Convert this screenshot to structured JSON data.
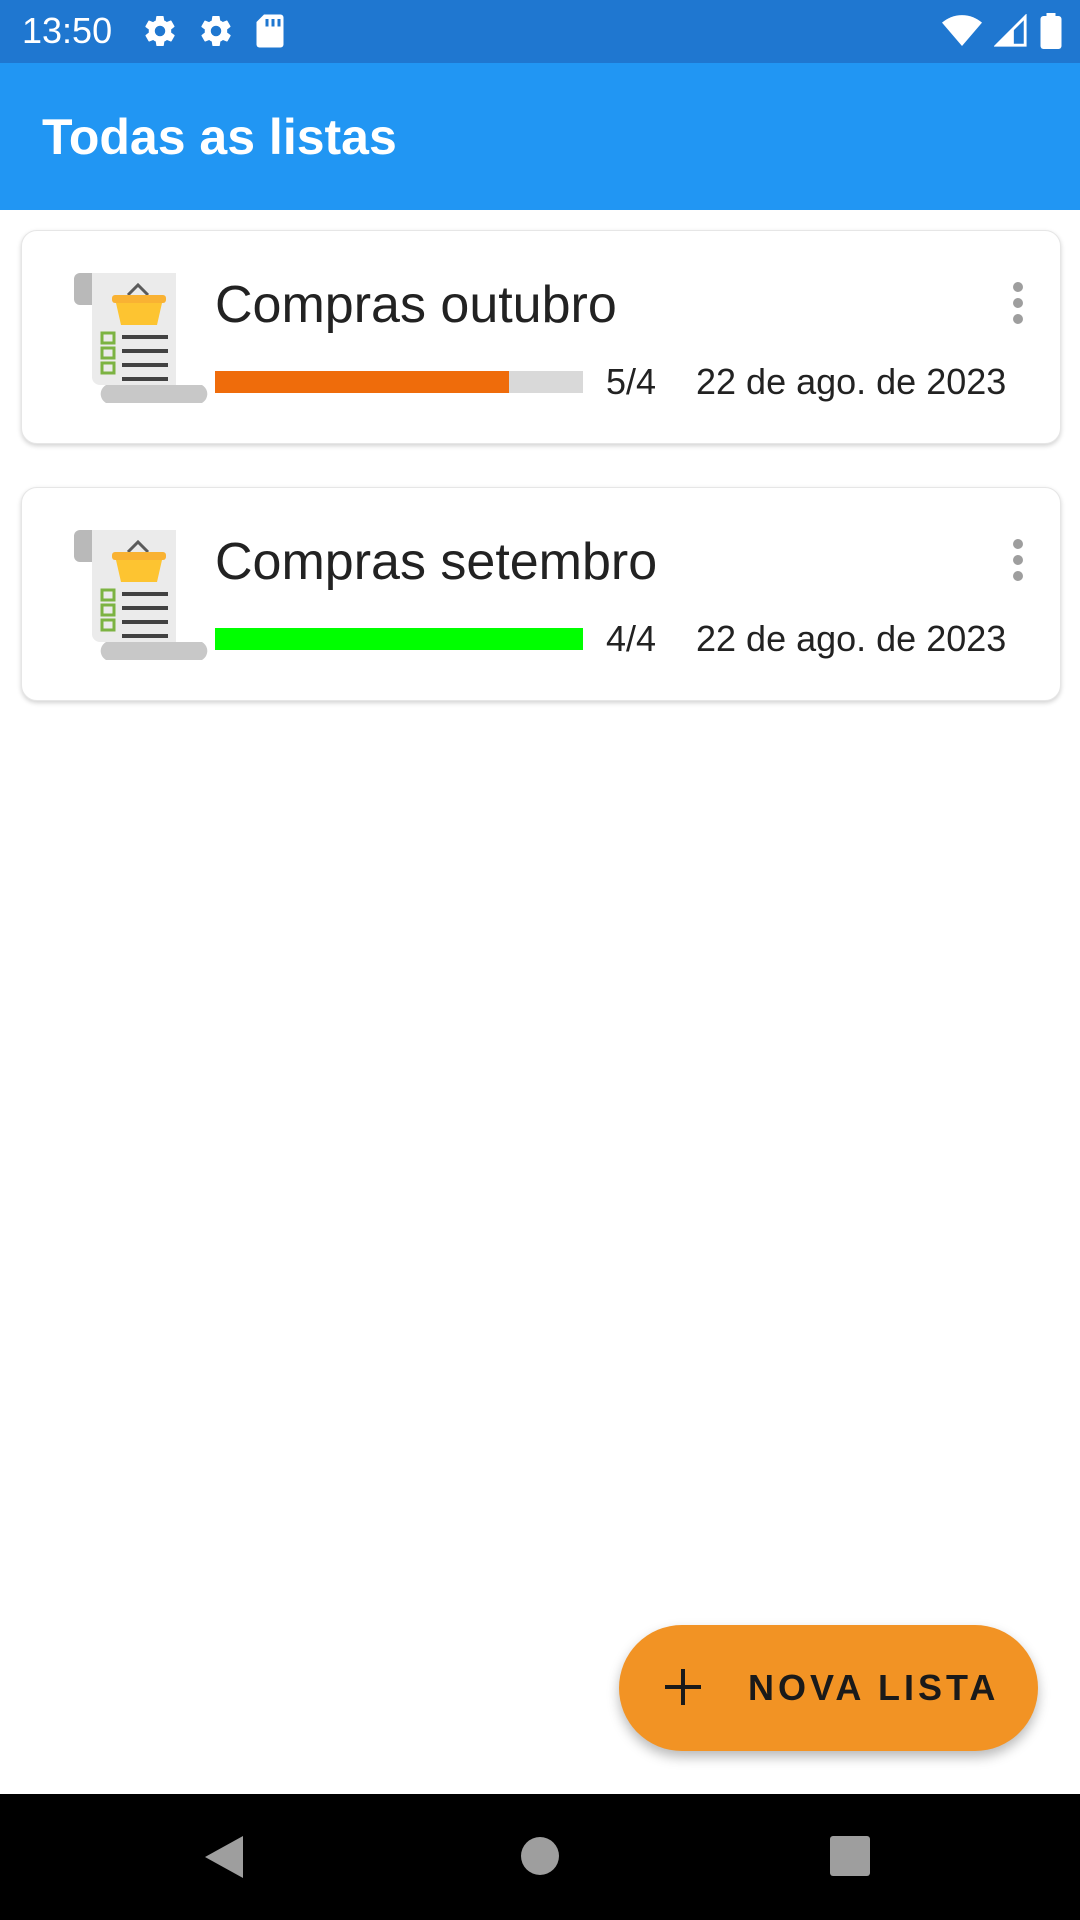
{
  "status_bar": {
    "time": "13:50",
    "left_icons": [
      "gear-icon",
      "gear-icon",
      "sd-card-icon"
    ],
    "right_icons": [
      "wifi-icon",
      "signal-icon",
      "battery-icon"
    ],
    "background": "#1f77d0"
  },
  "app_bar": {
    "title": "Todas as listas",
    "background": "#2196f3"
  },
  "lists": [
    {
      "name": "Compras outubro",
      "count": "5/4",
      "date": "22 de ago. de 2023",
      "progress": 0.8,
      "progress_color": "#ef6c0b",
      "icon": "shopping-list-icon",
      "menu_icon": "more-vert-icon"
    },
    {
      "name": "Compras setembro",
      "count": "4/4",
      "date": "22 de ago. de 2023",
      "progress": 1.0,
      "progress_color": "#00ff00",
      "icon": "shopping-list-icon",
      "menu_icon": "more-vert-icon"
    }
  ],
  "fab": {
    "label": "NOVA LISTA",
    "icon": "plus-icon",
    "color": "#f29324"
  },
  "nav_bar": {
    "buttons": [
      "back-icon",
      "home-icon",
      "recents-icon"
    ]
  }
}
